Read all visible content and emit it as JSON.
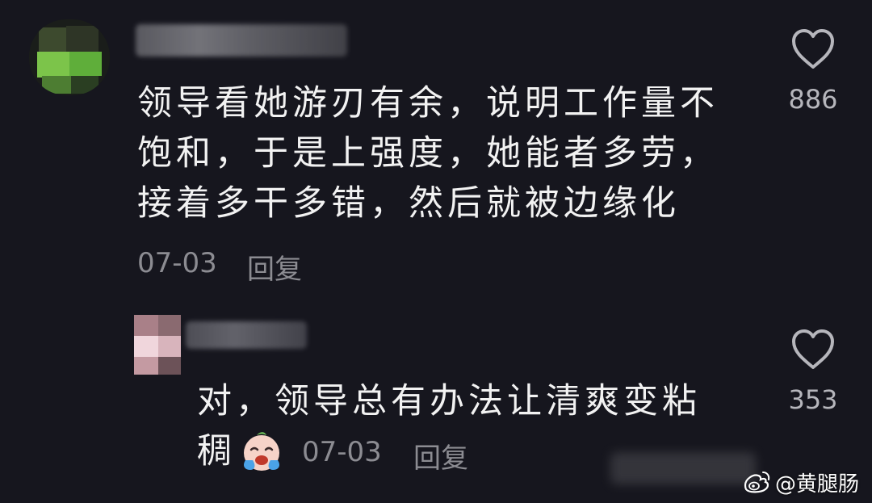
{
  "comments": [
    {
      "text": "领导看她游刃有余，说明工作量不\n饱和，于是上强度，她能者多劳，\n接着多干多错，然后就被边缘化",
      "date": "07-03",
      "reply_label": "回复",
      "likes": "886",
      "avatar_icon": "pixelated-avatar",
      "like_icon": "heart-outline-icon"
    },
    {
      "text": "对，领导总有办法让清爽变粘\n稠",
      "date": "07-03",
      "reply_label": "回复",
      "likes": "353",
      "emoji": "crying-face-emoji",
      "avatar_icon": "pixelated-avatar",
      "like_icon": "heart-outline-icon"
    }
  ],
  "watermark": {
    "text": "@黄腿肠",
    "icon": "weibo-logo"
  },
  "colors": {
    "background": "#16161e",
    "text": "#f2f2f2",
    "meta": "#8c8c92",
    "like_count": "#b6b6bc"
  }
}
